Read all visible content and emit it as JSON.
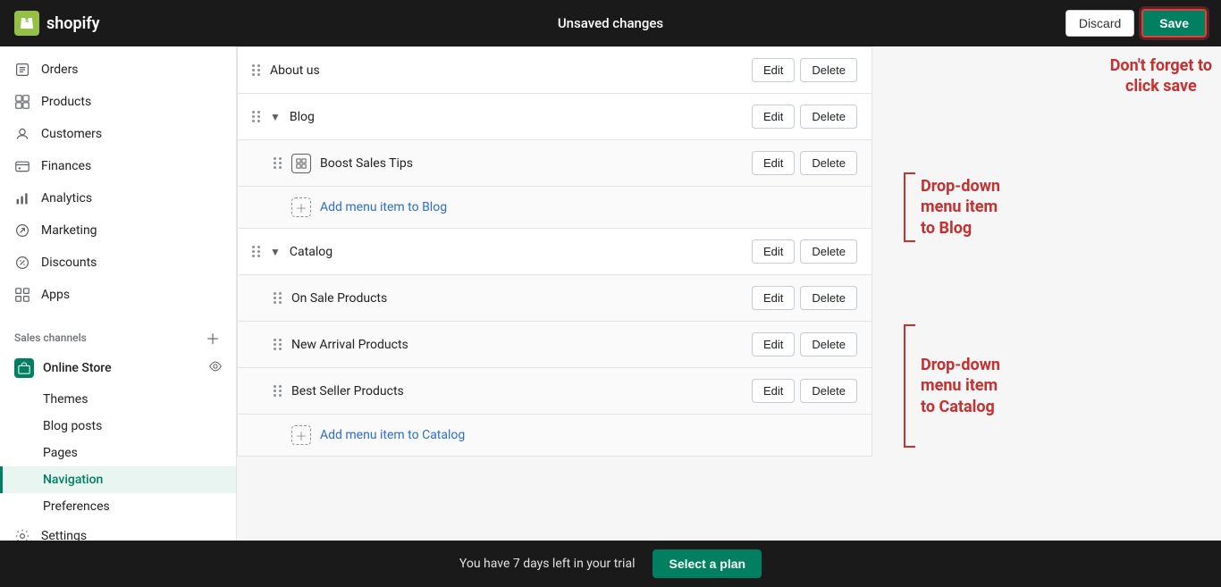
{
  "topbar": {
    "logo_text": "shopify",
    "title": "Unsaved changes",
    "discard_label": "Discard",
    "save_label": "Save"
  },
  "sidebar": {
    "nav_items": [
      {
        "id": "orders",
        "label": "Orders",
        "icon": "📋"
      },
      {
        "id": "products",
        "label": "Products",
        "icon": "🏷"
      },
      {
        "id": "customers",
        "label": "Customers",
        "icon": "👤"
      },
      {
        "id": "finances",
        "label": "Finances",
        "icon": "🏦"
      },
      {
        "id": "analytics",
        "label": "Analytics",
        "icon": "📊"
      },
      {
        "id": "marketing",
        "label": "Marketing",
        "icon": "📣"
      },
      {
        "id": "discounts",
        "label": "Discounts",
        "icon": "🎟"
      },
      {
        "id": "apps",
        "label": "Apps",
        "icon": "⊞"
      }
    ],
    "sales_channels_label": "Sales channels",
    "online_store_label": "Online Store",
    "sub_items": [
      {
        "id": "themes",
        "label": "Themes",
        "active": false
      },
      {
        "id": "blog-posts",
        "label": "Blog posts",
        "active": false
      },
      {
        "id": "pages",
        "label": "Pages",
        "active": false
      },
      {
        "id": "navigation",
        "label": "Navigation",
        "active": true
      },
      {
        "id": "preferences",
        "label": "Preferences",
        "active": false
      }
    ],
    "settings_label": "Settings"
  },
  "menu_items": [
    {
      "id": "about-us",
      "name": "About us",
      "indent": 0,
      "has_arrow": false,
      "is_add": false
    },
    {
      "id": "blog",
      "name": "Blog",
      "indent": 0,
      "has_arrow": true,
      "is_add": false
    },
    {
      "id": "boost-sales-tips",
      "name": "Boost Sales Tips",
      "indent": 1,
      "has_arrow": false,
      "is_add": false,
      "has_box": true
    },
    {
      "id": "add-to-blog",
      "name": "Add menu item to Blog",
      "indent": 1,
      "is_add": true,
      "has_box": true
    },
    {
      "id": "catalog",
      "name": "Catalog",
      "indent": 0,
      "has_arrow": true,
      "is_add": false
    },
    {
      "id": "on-sale",
      "name": "On Sale Products",
      "indent": 1,
      "has_arrow": false,
      "is_add": false,
      "has_box": false
    },
    {
      "id": "new-arrival",
      "name": "New Arrival Products",
      "indent": 1,
      "has_arrow": false,
      "is_add": false,
      "has_box": false
    },
    {
      "id": "best-seller",
      "name": "Best Seller Products",
      "indent": 1,
      "has_arrow": false,
      "is_add": false,
      "has_box": false
    },
    {
      "id": "add-to-catalog",
      "name": "Add menu item to Catalog",
      "indent": 1,
      "is_add": true,
      "has_box": true
    }
  ],
  "annotations": {
    "save_reminder": "Don't forget to\nclick save",
    "blog_dropdown": "Drop-down\nmenu item\nto Blog",
    "catalog_dropdown": "Drop-down\nmenu item\nto Catalog"
  },
  "bottom_bar": {
    "trial_text": "You have 7 days left in your trial",
    "select_plan_label": "Select a plan"
  }
}
